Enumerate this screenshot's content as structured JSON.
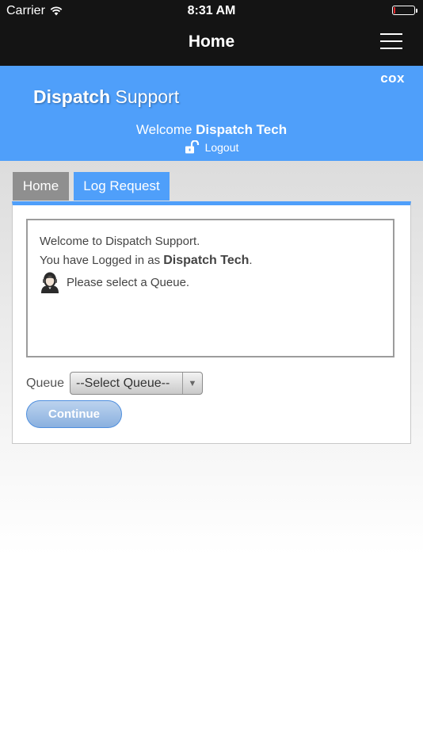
{
  "status_bar": {
    "carrier": "Carrier",
    "time": "8:31 AM",
    "battery_color": "#e0262b"
  },
  "nav": {
    "title": "Home",
    "menu_icon": "hamburger-menu-icon"
  },
  "header": {
    "logo": "cox",
    "brand_bold": "Dispatch",
    "brand_regular": " Support",
    "welcome_prefix": "Welcome ",
    "user_name": "Dispatch Tech",
    "logout_label": "Logout",
    "logout_icon": "unlock-icon",
    "background_color": "#4f9ffa"
  },
  "tabs": [
    {
      "label": "Home",
      "active": false
    },
    {
      "label": "Log Request",
      "active": true
    }
  ],
  "message_box": {
    "line1": "Welcome to Dispatch Support.",
    "line2_prefix": "You have Logged in as ",
    "line2_user": "Dispatch Tech",
    "line2_suffix": ".",
    "line3": "Please select a Queue.",
    "avatar_icon": "support-agent-icon"
  },
  "form": {
    "queue_label": "Queue",
    "queue_selected": "--Select Queue--",
    "continue_label": "Continue"
  }
}
